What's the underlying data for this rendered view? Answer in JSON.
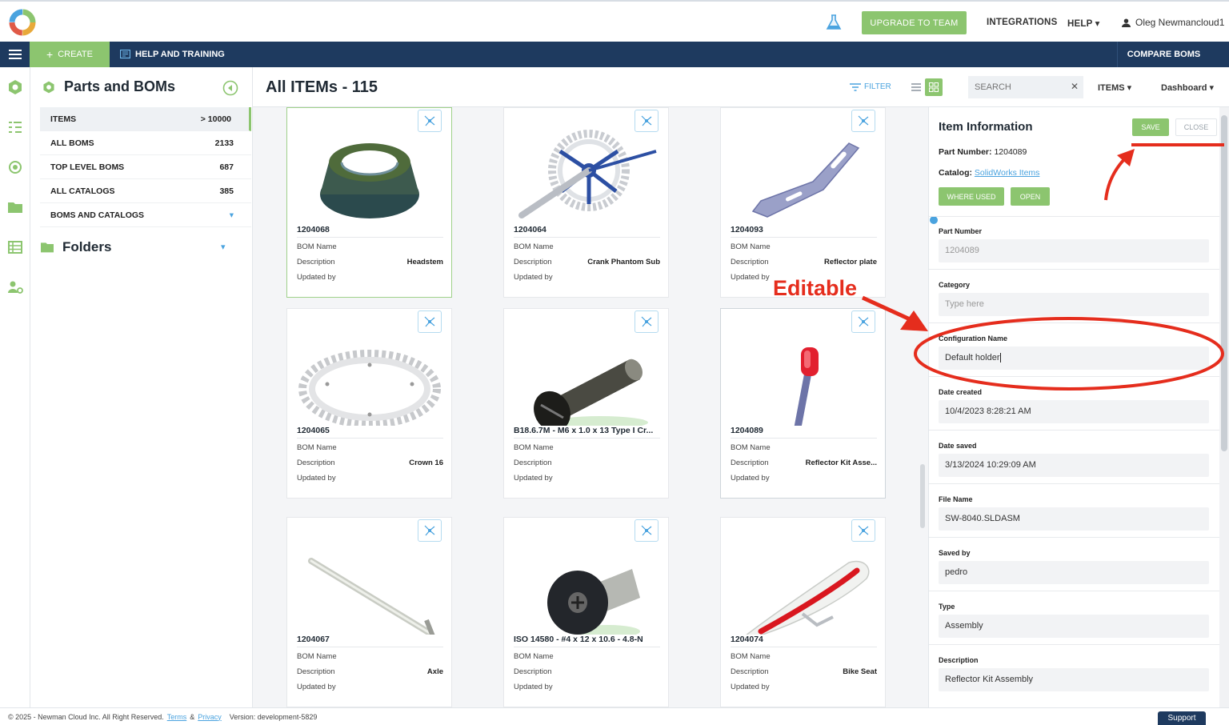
{
  "topbar": {
    "upgrade_label": "UPGRADE TO TEAM",
    "integrations_label": "INTEGRATIONS",
    "help_label": "HELP ▾",
    "user_name": "Oleg Newmancloud1"
  },
  "navbar": {
    "create_label": "CREATE",
    "help_training_label": "HELP AND TRAINING",
    "compare_label": "COMPARE BOMS"
  },
  "sidebar": {
    "title": "Parts and BOMs",
    "items": [
      {
        "label": "ITEMS",
        "count": "> 10000"
      },
      {
        "label": "ALL BOMS",
        "count": "2133"
      },
      {
        "label": "TOP LEVEL BOMS",
        "count": "687"
      },
      {
        "label": "ALL CATALOGS",
        "count": "385"
      },
      {
        "label": "BOMS AND CATALOGS",
        "count": "▾"
      }
    ],
    "folders_label": "Folders"
  },
  "main": {
    "title": "All ITEMs - 115",
    "filter_label": "FILTER",
    "search_placeholder": "SEARCH",
    "items_dropdown": "ITEMS ▾",
    "dashboard_dropdown": "Dashboard ▾"
  },
  "cards": [
    {
      "number": "1204068",
      "bom_label": "BOM Name",
      "desc_label": "Description",
      "description": "Headstem",
      "updated_label": "Updated by",
      "icon": "headstem-part"
    },
    {
      "number": "1204064",
      "bom_label": "BOM Name",
      "desc_label": "Description",
      "description": "Crank Phantom Sub",
      "updated_label": "Updated by",
      "icon": "crank-part"
    },
    {
      "number": "1204093",
      "bom_label": "BOM Name",
      "desc_label": "Description",
      "description": "Reflector plate",
      "updated_label": "Updated by",
      "icon": "reflector-plate-part"
    },
    {
      "number": "1204065",
      "bom_label": "BOM Name",
      "desc_label": "Description",
      "description": "Crown 16",
      "updated_label": "Updated by",
      "icon": "crown-gear-part"
    },
    {
      "number": "B18.6.7M - M6 x 1.0 x 13 Type I Cr...",
      "bom_label": "BOM Name",
      "desc_label": "Description",
      "description": "",
      "updated_label": "Updated by",
      "icon": "screw-part"
    },
    {
      "number": "1204089",
      "bom_label": "BOM Name",
      "desc_label": "Description",
      "description": "Reflector Kit Asse...",
      "updated_label": "Updated by",
      "icon": "reflector-kit-part"
    },
    {
      "number": "1204067",
      "bom_label": "BOM Name",
      "desc_label": "Description",
      "description": "Axle",
      "updated_label": "Updated by",
      "icon": "axle-part"
    },
    {
      "number": "ISO 14580 - #4 x 12 x 10.6 - 4.8-N",
      "bom_label": "BOM Name",
      "desc_label": "Description",
      "description": "",
      "updated_label": "Updated by",
      "icon": "bolt-part"
    },
    {
      "number": "1204074",
      "bom_label": "BOM Name",
      "desc_label": "Description",
      "description": "Bike Seat",
      "updated_label": "Updated by",
      "icon": "bike-seat-part"
    }
  ],
  "panel": {
    "title": "Item Information",
    "save_label": "SAVE",
    "close_label": "CLOSE",
    "part_number_label": "Part Number:",
    "part_number_value": "1204089",
    "catalog_label": "Catalog:",
    "catalog_value": "SolidWorks Items",
    "where_used_label": "WHERE USED",
    "open_label": "OPEN",
    "fields": [
      {
        "label": "Part Number",
        "value": "1204089",
        "placeholder": false
      },
      {
        "label": "Category",
        "value": "Type here",
        "placeholder": true
      },
      {
        "label": "Configuration Name",
        "value": "Default holder",
        "placeholder": false
      },
      {
        "label": "Date created",
        "value": "10/4/2023 8:28:21 AM",
        "placeholder": false
      },
      {
        "label": "Date saved",
        "value": "3/13/2024 10:29:09 AM",
        "placeholder": false
      },
      {
        "label": "File Name",
        "value": "SW-8040.SLDASM",
        "placeholder": false
      },
      {
        "label": "Saved by",
        "value": "pedro",
        "placeholder": false
      },
      {
        "label": "Type",
        "value": "Assembly",
        "placeholder": false
      },
      {
        "label": "Description",
        "value": "Reflector Kit Assembly",
        "placeholder": false
      }
    ]
  },
  "annotation": {
    "text": "Editable",
    "color": "#e52d1d"
  },
  "footer": {
    "copyright": "© 2025 - Newman Cloud Inc. All Right Reserved.",
    "terms": "Terms",
    "amp": "&",
    "privacy": "Privacy",
    "version": "Version: development-5829",
    "support_label": "Support"
  },
  "colors": {
    "accent_green": "#8cc56f",
    "nav_blue": "#1e3a5f",
    "link_blue": "#4aa3df"
  }
}
